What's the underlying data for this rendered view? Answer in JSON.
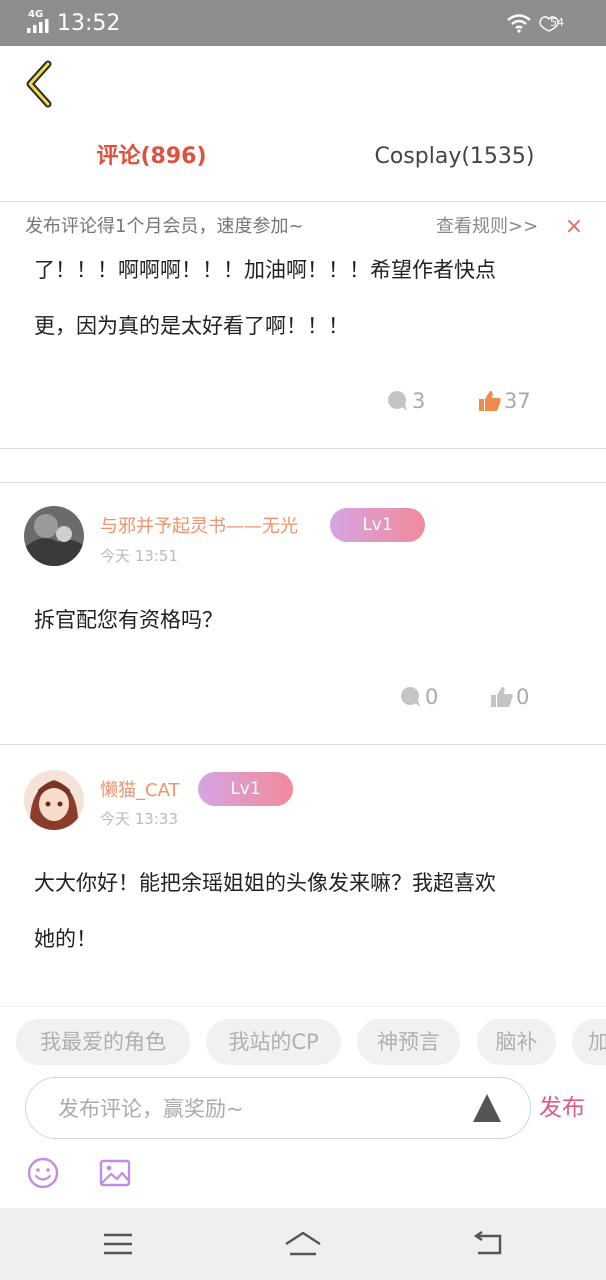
{
  "status": {
    "network": "4G",
    "time": "13:52",
    "battery": "54"
  },
  "tabs": [
    {
      "label": "评论(896)"
    },
    {
      "label": "Cosplay(1535)"
    }
  ],
  "notice": {
    "message": "发布评论得1个月会员，速度参加~",
    "rules": "查看规则>>",
    "close": "×"
  },
  "comments": [
    {
      "text_lines": [
        "了！！！啊啊啊！！！加油啊！！！希望作者快点",
        "更，因为真的是太好看了啊！！！"
      ],
      "replies": "3",
      "likes": "37"
    },
    {
      "username": "与邪并予起灵书——无光",
      "level": "Lv1",
      "time": "今天 13:51",
      "text_lines": [
        "拆官配您有资格吗？"
      ],
      "replies": "0",
      "likes": "0"
    },
    {
      "username": "懒猫_CAT",
      "level": "Lv1",
      "time": "今天 13:33",
      "text_lines": [
        "大大你好！能把余瑶姐姐的头像发来嘛？我超喜欢",
        "她的！"
      ]
    }
  ],
  "tags": [
    "我最爱的角色",
    "我站的CP",
    "神预言",
    "脑补",
    "加"
  ],
  "input": {
    "placeholder": "发布评论，赢奖励~",
    "publish_label": "发布"
  },
  "colors": {
    "accent_tab": "#e0503a",
    "like_active": "#f08a4b",
    "username": "#f0936a",
    "publish": "#e05a8c",
    "icon_purple": "#c58be0"
  }
}
